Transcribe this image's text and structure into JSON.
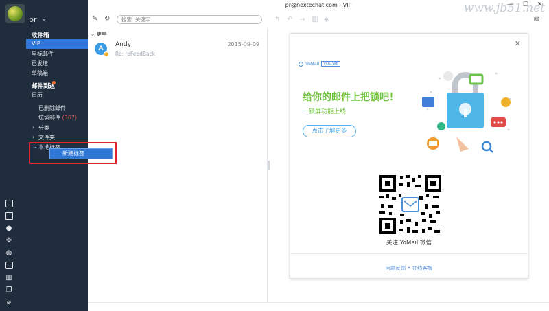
{
  "window": {
    "title": "pr@nextechat.com - VIP",
    "minimize": "—",
    "maximize": "☐",
    "close": "✕",
    "watermark": "www.jb51.net"
  },
  "account": {
    "name": "pr",
    "caret": "⌄"
  },
  "sidebar": {
    "inbox": "收件箱",
    "vip": "VIP",
    "starred": "星标邮件",
    "sent": "已发送",
    "drafts": "草稿箱",
    "todo": "邮件到达",
    "calendar": "日历",
    "deleted": "已删除邮件",
    "junk": "垃圾邮件",
    "junk_count": "(367)",
    "categories": "分类",
    "folders": "文件夹",
    "local_tags": "本地标签",
    "context_menu_item": "新建标签"
  },
  "search": {
    "placeholder": "搜索: 关键字"
  },
  "mail_list": {
    "group_header": "更早",
    "items": [
      {
        "avatar": "A",
        "sender": "Andy",
        "date": "2015-09-09",
        "subject": "Re: reFeedBack"
      }
    ]
  },
  "promo": {
    "brand": "YoMail",
    "version": "VOL.WB",
    "headline": "给你的邮件上把锁吧！",
    "subheadline": "一锁屏功能上线",
    "learn_more": "点击了解更多",
    "qr_caption": "关注 YoMail 微信",
    "feedback": "问题反馈",
    "separator": "•",
    "support": "在线客服"
  }
}
